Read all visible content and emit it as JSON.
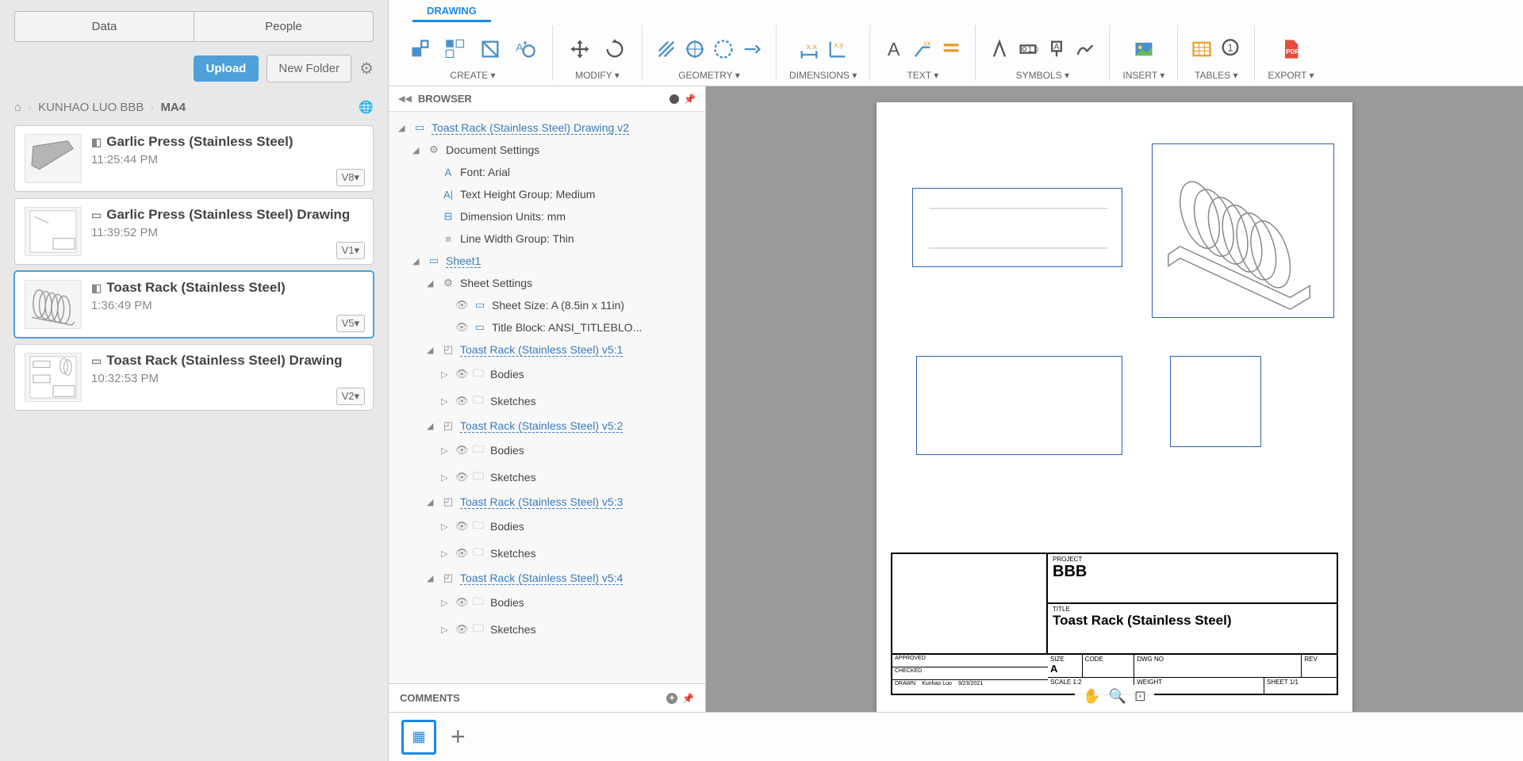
{
  "left": {
    "tabs": [
      "Data",
      "People"
    ],
    "upload": "Upload",
    "newFolder": "New Folder",
    "crumbs": {
      "proj": "KUNHAO LUO BBB",
      "folder": "MA4"
    },
    "items": [
      {
        "name": "Garlic Press (Stainless Steel)",
        "time": "11:25:44 PM",
        "ver": "V8▾",
        "type": "3d"
      },
      {
        "name": "Garlic Press (Stainless Steel) Drawing",
        "time": "11:39:52 PM",
        "ver": "V1▾",
        "type": "dwg"
      },
      {
        "name": "Toast Rack (Stainless Steel)",
        "time": "1:36:49 PM",
        "ver": "V5▾",
        "type": "3d",
        "active": true
      },
      {
        "name": "Toast Rack (Stainless Steel) Drawing",
        "time": "10:32:53 PM",
        "ver": "V2▾",
        "type": "dwg"
      }
    ]
  },
  "ribbon": {
    "tab": "DRAWING",
    "groups": [
      "CREATE ▾",
      "MODIFY ▾",
      "GEOMETRY ▾",
      "DIMENSIONS ▾",
      "TEXT ▾",
      "SYMBOLS ▾",
      "INSERT ▾",
      "TABLES ▾",
      "EXPORT ▾"
    ]
  },
  "browser": {
    "title": "BROWSER",
    "root": "Toast Rack (Stainless Steel) Drawing v2",
    "docSettings": "Document Settings",
    "font": "Font: Arial",
    "textHeight": "Text Height Group: Medium",
    "dimUnits": "Dimension Units: mm",
    "lineWidth": "Line Width Group: Thin",
    "sheet": "Sheet1",
    "sheetSettings": "Sheet Settings",
    "sheetSize": "Sheet Size: A (8.5in x 11in)",
    "titleBlock": "Title Block: ANSI_TITLEBLO...",
    "refs": [
      {
        "name": "Toast Rack (Stainless Steel) v5:1",
        "bodies": "Bodies",
        "sketches": "Sketches"
      },
      {
        "name": "Toast Rack (Stainless Steel) v5:2",
        "bodies": "Bodies",
        "sketches": "Sketches"
      },
      {
        "name": "Toast Rack (Stainless Steel) v5:3",
        "bodies": "Bodies",
        "sketches": "Sketches"
      },
      {
        "name": "Toast Rack (Stainless Steel) v5:4",
        "bodies": "Bodies",
        "sketches": "Sketches"
      }
    ],
    "comments": "COMMENTS"
  },
  "titleblock": {
    "projectLbl": "PROJECT",
    "project": "BBB",
    "titleLbl": "TITLE",
    "title": "Toast Rack (Stainless Steel)",
    "approved": "APPROVED",
    "checked": "CHECKED",
    "drawn": "DRAWN",
    "drawnBy": "Kunhao Luo",
    "drawnDate": "9/23/2021",
    "sizeLbl": "SIZE",
    "size": "A",
    "codeLbl": "CODE",
    "dwgLbl": "DWG NO",
    "revLbl": "REV",
    "scaleLbl": "SCALE",
    "scale": "1:2",
    "weightLbl": "WEIGHT",
    "sheetLbl": "SHEET",
    "sheetNo": "1/1"
  }
}
